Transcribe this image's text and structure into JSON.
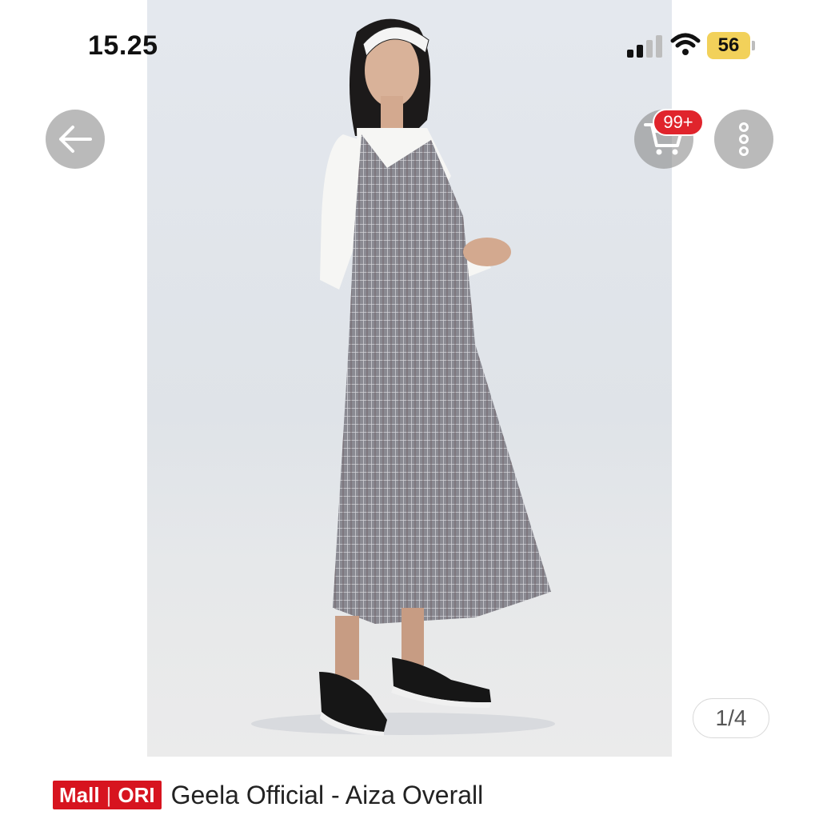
{
  "status_bar": {
    "time": "15.25",
    "battery": "56",
    "battery_color": "#f2d15a",
    "icons": [
      "signal-icon",
      "wifi-icon",
      "battery-icon"
    ]
  },
  "nav": {
    "icons": [
      "back-arrow-icon",
      "shopping-cart-icon",
      "more-vertical-icon"
    ],
    "cart_badge": "99+",
    "badge_color": "#e0242c"
  },
  "gallery": {
    "page_indicator": "1/4"
  },
  "product": {
    "badge_mall": "Mall",
    "badge_ori": "ORI",
    "badge_color": "#d7141f",
    "title": "Geela Official - Aiza Overall"
  }
}
